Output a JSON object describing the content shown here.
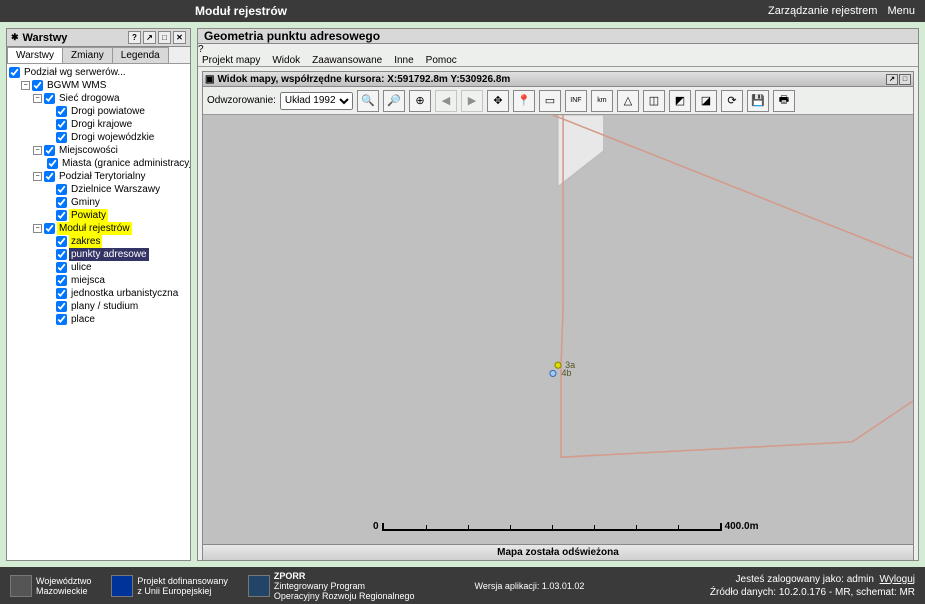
{
  "app": {
    "title": "Moduł rejestrów"
  },
  "top_links": {
    "manage": "Zarządzanie rejestrem",
    "menu": "Menu"
  },
  "left": {
    "title": "Warstwy",
    "tabs": [
      "Warstwy",
      "Zmiany",
      "Legenda"
    ],
    "tree": {
      "root": "Podział wg serwerów...",
      "bgwm": "BGWM WMS",
      "siec": "Sieć drogowa",
      "drogi_p": "Drogi powiatowe",
      "drogi_k": "Drogi krajowe",
      "drogi_w": "Drogi wojewódzkie",
      "miejsc": "Miejscowości",
      "miasta": "Miasta (granice administracyjne)",
      "podzial": "Podział Terytorialny",
      "dzielnice": "Dzielnice Warszawy",
      "gminy": "Gminy",
      "powiaty": "Powiaty",
      "modul": "Moduł rejestrów",
      "zakres": "zakres",
      "punkty": "punkty adresowe",
      "ulice": "ulice",
      "miejsca": "miejsca",
      "jednostka": "jednostka urbanistyczna",
      "plany": "plany / studium",
      "place": "place"
    }
  },
  "right": {
    "title": "Geometria punktu adresowego",
    "menu": [
      "Projekt mapy",
      "Widok",
      "Zaawansowane",
      "Inne",
      "Pomoc"
    ],
    "map_title": "Widok mapy, współrzędne kursora: X:591792.8m Y:530926.8m",
    "projection_label": "Odwzorowanie:",
    "projection_value": "Układ 1992",
    "scale": {
      "zero": "0",
      "val": "400.0m"
    },
    "status": "Mapa została odświeżona",
    "points": {
      "a": "3a",
      "b": "4b"
    }
  },
  "footer": {
    "woj1": "Województwo",
    "woj2": "Mazowieckie",
    "proj1": "Projekt dofinansowany",
    "proj2": "z Unii Europejskiej",
    "zporr1": "ZPORR",
    "zporr2": "Zintegrowany Program",
    "zporr3": "Operacyjny Rozwoju Regionalnego",
    "version": "Wersja aplikacji: 1.03.01.02",
    "login": "Jesteś zalogowany jako: admin",
    "logout": "Wyloguj",
    "source": "Źródło danych: 10.2.0.176 - MR, schemat: MR"
  }
}
